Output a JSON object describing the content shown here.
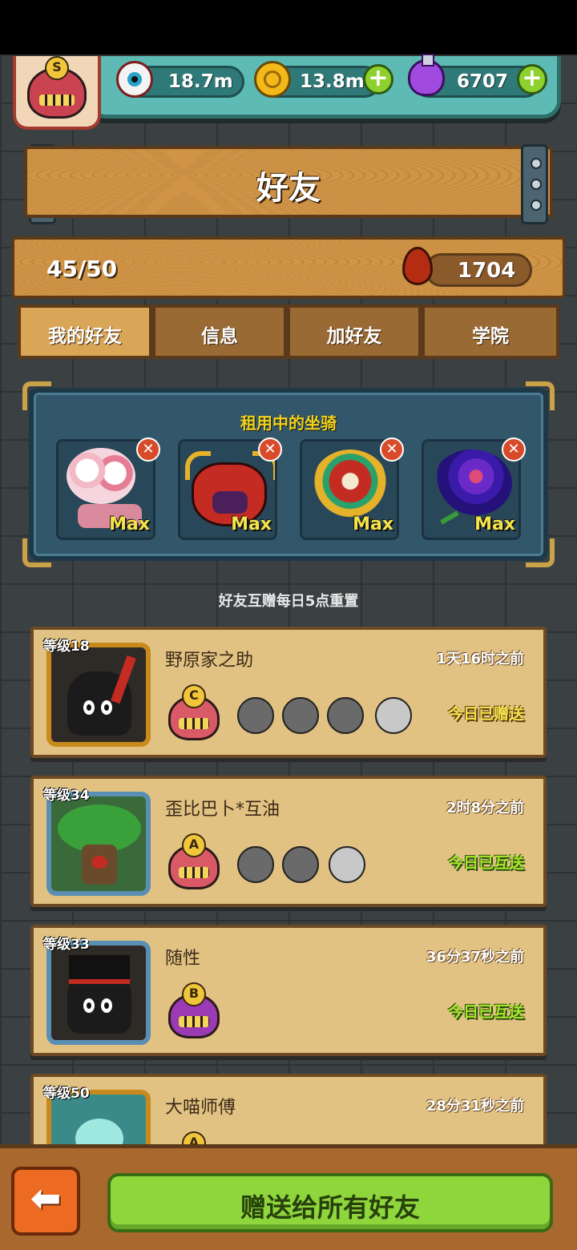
{
  "resources": {
    "eyeballs": "18.7m",
    "coins": "13.8m",
    "potions": "6707",
    "player_rank": "S"
  },
  "header": {
    "title": "好友"
  },
  "summary": {
    "friend_count": "45/50",
    "blood_drops": "1704"
  },
  "tabs": [
    {
      "label": "我的好友",
      "active": true
    },
    {
      "label": "信息"
    },
    {
      "label": "加好友"
    },
    {
      "label": "学院"
    }
  ],
  "rental": {
    "title": "租用中的坐骑",
    "mounts": [
      {
        "name": "cotton-candy-balloon-mount",
        "level": "Max"
      },
      {
        "name": "red-horned-demon-mount",
        "level": "Max"
      },
      {
        "name": "lion-dance-mount",
        "level": "Max"
      },
      {
        "name": "purple-rose-mount",
        "level": "Max"
      }
    ]
  },
  "reset_note": "好友互赠每日5点重置",
  "friends": [
    {
      "level": "等级18",
      "name": "野原家之助",
      "time": "1天16时之前",
      "rank": "C",
      "status": "今日已赠送",
      "status_color": "#f6e34a",
      "minis": 4
    },
    {
      "level": "等级34",
      "name": "歪比巴卜*互油",
      "time": "2时8分之前",
      "rank": "A",
      "status": "今日已互送",
      "status_color": "#a6e62a",
      "minis": 3
    },
    {
      "level": "等级33",
      "name": "随性",
      "time": "36分37秒之前",
      "rank": "B",
      "status": "今日已互送",
      "status_color": "#a6e62a",
      "minis": 0
    },
    {
      "level": "等级50",
      "name": "大喵师傅",
      "time": "28分31秒之前",
      "rank": "A",
      "status": "",
      "minis": 0
    }
  ],
  "footer": {
    "back_icon": "back-arrow-icon",
    "send_all": "赠送给所有好友"
  }
}
